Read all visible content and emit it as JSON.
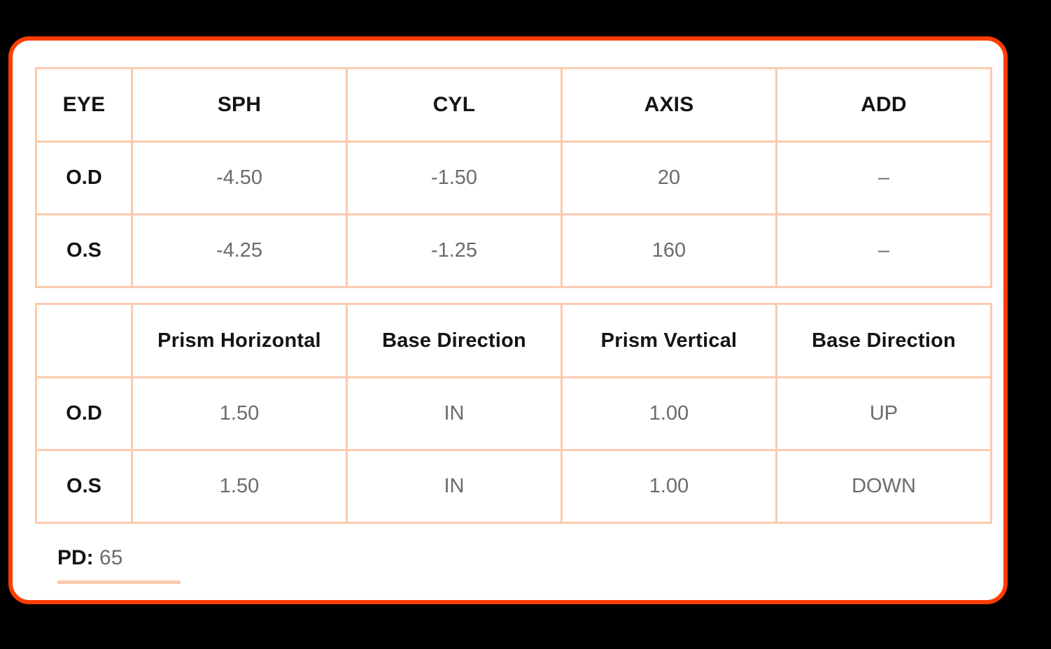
{
  "card": {
    "border_color": "#FF3D00",
    "background": "#FFFFFF"
  },
  "theme": {
    "accent": "#F95B14",
    "table_border": "#FBCBAE",
    "value_text": "#6B6B6B",
    "label_text": "#141414"
  },
  "prescription_table": {
    "headers": [
      "EYE",
      "SPH",
      "CYL",
      "AXIS",
      "ADD"
    ],
    "rows": [
      {
        "eye": "O.D",
        "sph": "-4.50",
        "cyl": "-1.50",
        "axis": "20",
        "add": "–"
      },
      {
        "eye": "O.S",
        "sph": "-4.25",
        "cyl": "-1.25",
        "axis": "160",
        "add": "–"
      }
    ]
  },
  "prism_table": {
    "headers": [
      "",
      "Prism Horizontal",
      "Base Direction",
      "Prism Vertical",
      "Base Direction"
    ],
    "rows": [
      {
        "eye": "O.D",
        "prism_horizontal": "1.50",
        "base_direction_h": "IN",
        "prism_vertical": "1.00",
        "base_direction_v": "UP"
      },
      {
        "eye": "O.S",
        "prism_horizontal": "1.50",
        "base_direction_h": "IN",
        "prism_vertical": "1.00",
        "base_direction_v": "DOWN"
      }
    ]
  },
  "pd": {
    "label": "PD:",
    "value": "65"
  }
}
